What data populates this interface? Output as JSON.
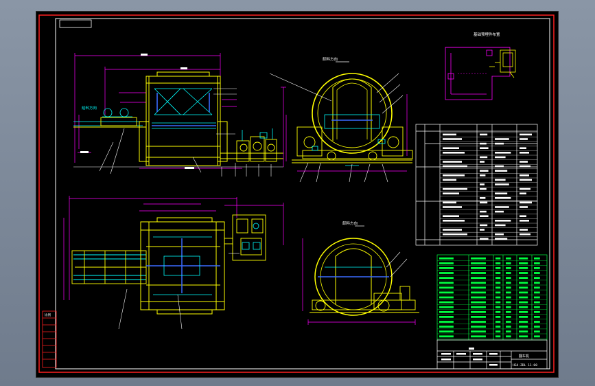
{
  "colors": {
    "background": "#000000",
    "frame": "#ff2020",
    "structure": "#ffff00",
    "dimension": "#ff00ff",
    "component": "#00ffff",
    "accent_blue": "#3a6bff",
    "table_green": "#00ff40",
    "text_white": "#ffffff"
  },
  "labels": {
    "direction_top": "卸料方向",
    "direction_left": "给料方向",
    "direction_bottom": "卸料方向",
    "detail_title": "基础预埋件布置",
    "title_block_name": "翻车机",
    "title_block_code": "HG4-ZDL 11-00",
    "side_scale_label": "比例"
  },
  "icons": [
    "pinion-gear-icon",
    "rotor-ring-icon",
    "wagon-wheel-icon"
  ]
}
